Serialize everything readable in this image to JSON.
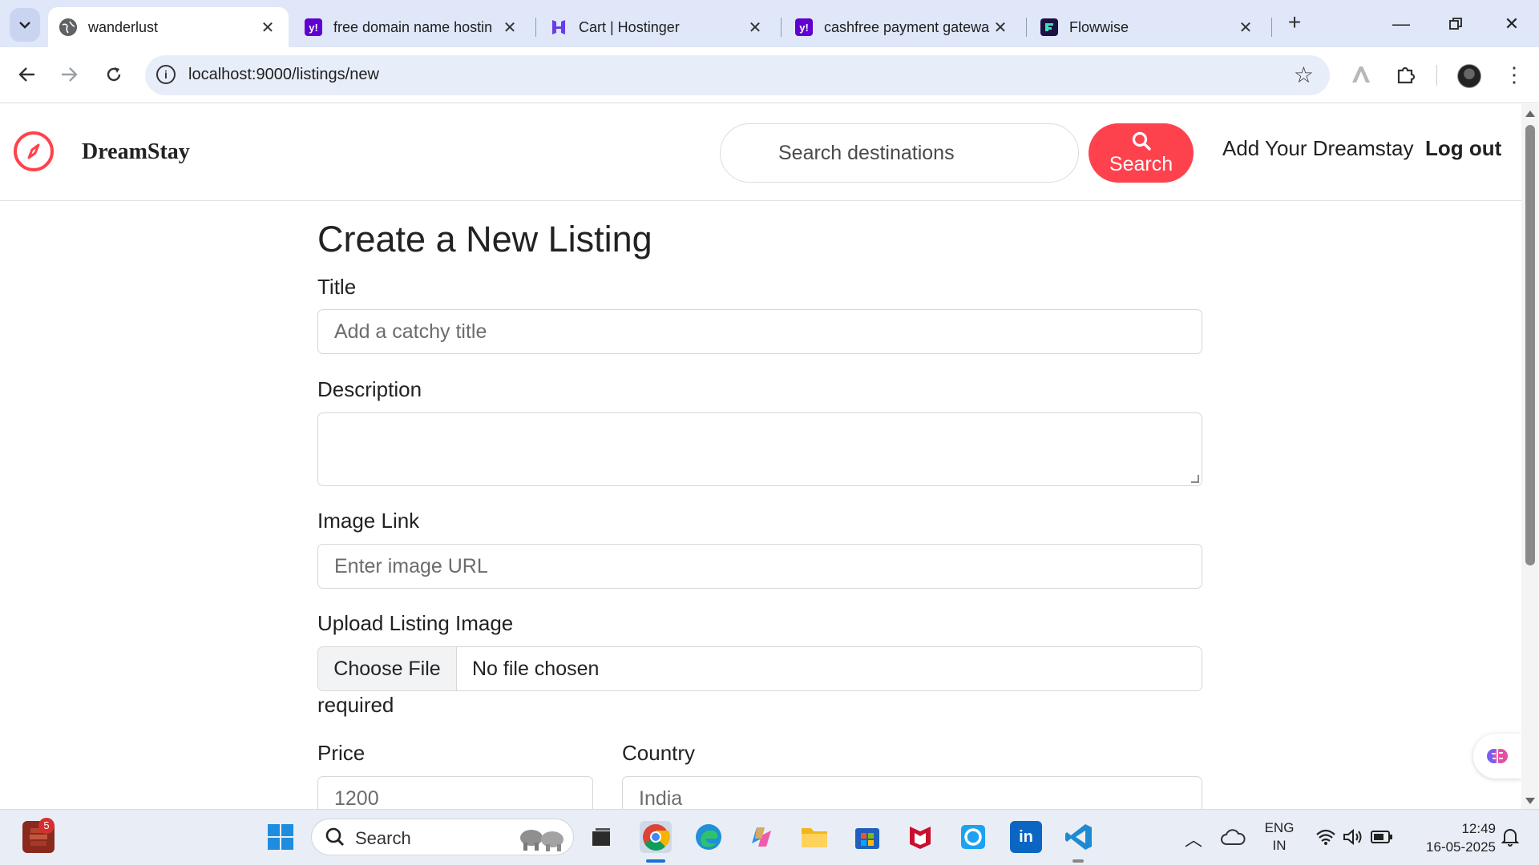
{
  "browser": {
    "tabs": [
      {
        "title": "wanderlust",
        "active": true,
        "favicon": "globe-icon"
      },
      {
        "title": "free domain name hostin",
        "active": false,
        "favicon": "yahoo-icon"
      },
      {
        "title": "Cart | Hostinger",
        "active": false,
        "favicon": "hostinger-icon"
      },
      {
        "title": "cashfree payment gatewa",
        "active": false,
        "favicon": "yahoo-icon"
      },
      {
        "title": "Flowwise",
        "active": false,
        "favicon": "flowwise-icon"
      }
    ],
    "url": "localhost:9000/listings/new"
  },
  "site": {
    "brand": "DreamStay",
    "search_placeholder": "Search destinations",
    "search_button": "Search",
    "nav_add": "Add Your Dreamstay",
    "nav_logout": "Log out",
    "accent_color": "#fe424d"
  },
  "form": {
    "heading": "Create a New Listing",
    "title_label": "Title",
    "title_placeholder": "Add a catchy title",
    "description_label": "Description",
    "image_link_label": "Image Link",
    "image_link_placeholder": "Enter image URL",
    "upload_label": "Upload Listing Image",
    "choose_file": "Choose File",
    "no_file": "No file chosen",
    "required_text": "required",
    "price_label": "Price",
    "price_placeholder": "1200",
    "country_label": "Country",
    "country_placeholder": "India"
  },
  "taskbar": {
    "search_label": "Search",
    "notification_count": "5",
    "lang_1": "ENG",
    "lang_2": "IN",
    "time": "12:49",
    "date": "16-05-2025"
  }
}
